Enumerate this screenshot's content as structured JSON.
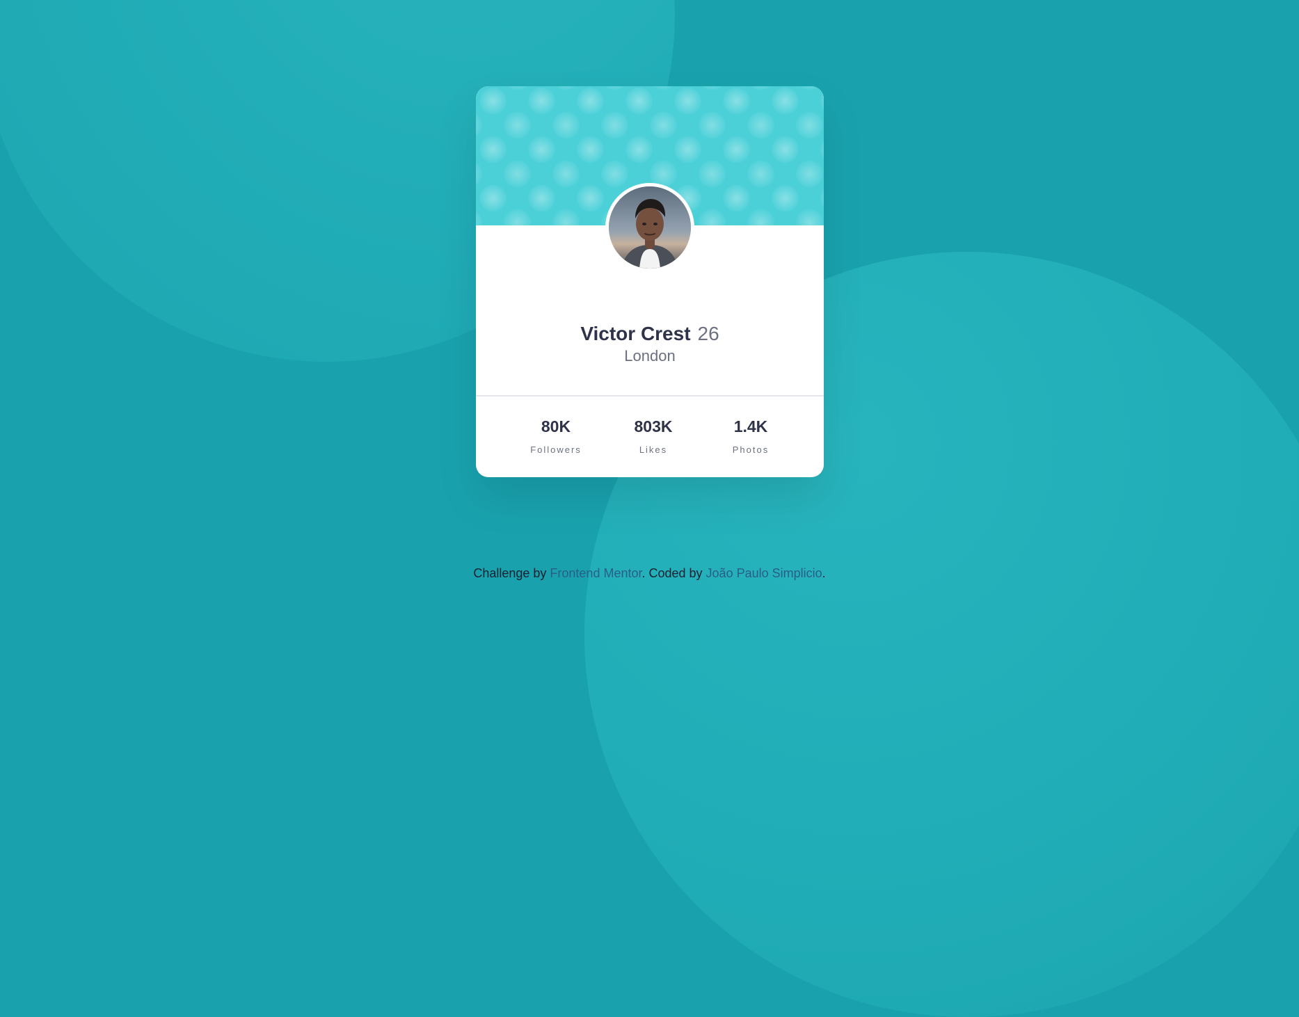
{
  "profile": {
    "name": "Victor Crest",
    "age": "26",
    "location": "London"
  },
  "stats": [
    {
      "value": "80K",
      "label": "Followers"
    },
    {
      "value": "803K",
      "label": "Likes"
    },
    {
      "value": "1.4K",
      "label": "Photos"
    }
  ],
  "footer": {
    "prefix": "Challenge by ",
    "mentor_link": "Frontend Mentor",
    "middle": ". Coded by ",
    "author_link": "João Paulo Simplicio",
    "suffix": "."
  },
  "colors": {
    "background": "#19a2ae",
    "header_pattern": "#4bd0d8",
    "card": "#ffffff",
    "text_primary": "#2e3349",
    "text_secondary": "#6b7082"
  },
  "icons": {
    "avatar": "profile-photo"
  }
}
